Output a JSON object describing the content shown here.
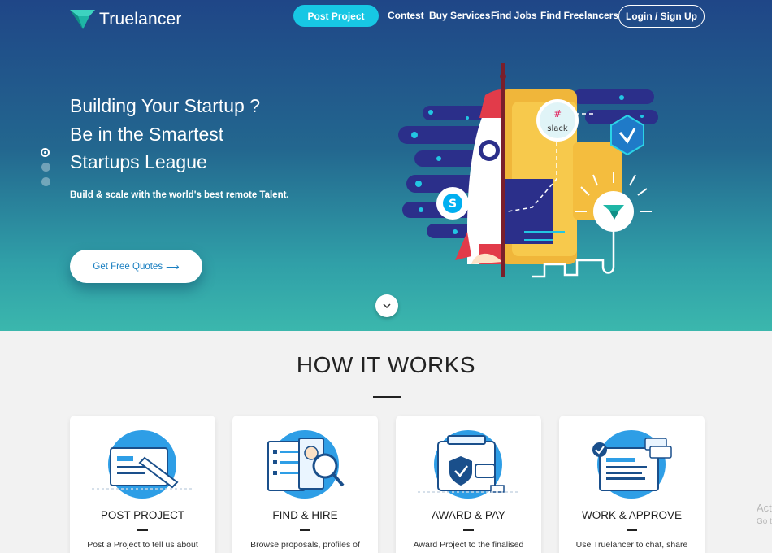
{
  "brand": {
    "name": "Truelancer"
  },
  "nav": {
    "post_project": "Post Project",
    "links": [
      "Contest",
      "Buy Services",
      "Find Jobs",
      "Find Freelancers"
    ],
    "login": "Login / Sign Up"
  },
  "hero": {
    "title_lines": [
      "Building Your Startup ?",
      "Be in the Smartest",
      "Startups League"
    ],
    "subtitle": "Build & scale with the world's best remote Talent.",
    "cta": "Get Free Quotes",
    "cta_arrow": "⟶",
    "slides": {
      "count": 3,
      "active": 0
    },
    "illustration_labels": {
      "slack": "slack"
    }
  },
  "how": {
    "title": "HOW IT WORKS",
    "cards": [
      {
        "title": "POST PROJECT",
        "desc": "Post a Project to tell us about",
        "icon": "post-project-illustration-icon"
      },
      {
        "title": "FIND & HIRE",
        "desc": "Browse proposals, profiles of",
        "icon": "find-hire-illustration-icon"
      },
      {
        "title": "AWARD & PAY",
        "desc": "Award Project to the finalised",
        "icon": "award-pay-illustration-icon"
      },
      {
        "title": "WORK & APPROVE",
        "desc": "Use Truelancer to chat, share",
        "icon": "work-approve-illustration-icon"
      }
    ]
  },
  "watermark": {
    "line1": "Act",
    "line2": "Go t"
  },
  "colors": {
    "accent": "#17c7e4",
    "hero_top": "#1f4687",
    "hero_bottom": "#3bb7ad",
    "link_blue": "#1a7fc1"
  }
}
